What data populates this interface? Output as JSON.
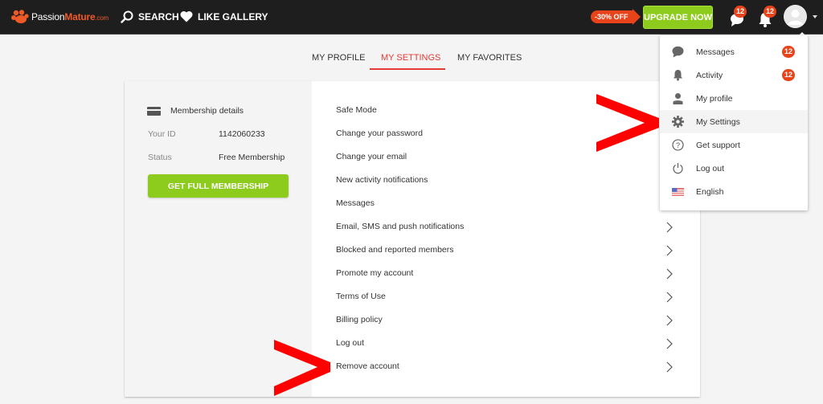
{
  "header": {
    "logo_part1": "Passion",
    "logo_part2": "Mature",
    "logo_part3": ".com",
    "search_label": "SEARCH",
    "like_gallery_label": "LIKE GALLERY",
    "promo_label": "-30% OFF",
    "upgrade_label": "UPGRADE NOW",
    "messages_badge": "12",
    "activity_badge": "12"
  },
  "tabs": [
    {
      "label": "MY PROFILE",
      "active": false
    },
    {
      "label": "MY SETTINGS",
      "active": true
    },
    {
      "label": "MY FAVORITES",
      "active": false
    }
  ],
  "membership": {
    "title": "Membership details",
    "id_label": "Your ID",
    "id_value": "1142060233",
    "status_label": "Status",
    "status_value": "Free Membership",
    "cta_label": "GET FULL MEMBERSHIP"
  },
  "settings": [
    {
      "label": "Safe Mode"
    },
    {
      "label": "Change your password"
    },
    {
      "label": "Change your email"
    },
    {
      "label": "New activity notifications"
    },
    {
      "label": "Messages"
    },
    {
      "label": "Email, SMS and push notifications"
    },
    {
      "label": "Blocked and reported members"
    },
    {
      "label": "Promote my account"
    },
    {
      "label": "Terms of Use"
    },
    {
      "label": "Billing policy"
    },
    {
      "label": "Log out"
    },
    {
      "label": "Remove account"
    }
  ],
  "dropdown": {
    "items": [
      {
        "label": "Messages",
        "icon": "chat-bubble-icon",
        "badge": "12"
      },
      {
        "label": "Activity",
        "icon": "bell-icon",
        "badge": "12"
      },
      {
        "label": "My profile",
        "icon": "user-icon"
      },
      {
        "label": "My Settings",
        "icon": "gear-icon",
        "active": true
      },
      {
        "label": "Get support",
        "icon": "question-circle-icon"
      },
      {
        "label": "Log out",
        "icon": "power-icon"
      },
      {
        "label": "English",
        "icon": "us-flag-icon"
      }
    ]
  },
  "colors": {
    "accent_red": "#e53935",
    "cta_green": "#8dcc1c",
    "badge_orange": "#e8431b",
    "annotation_red": "#ff0000"
  }
}
